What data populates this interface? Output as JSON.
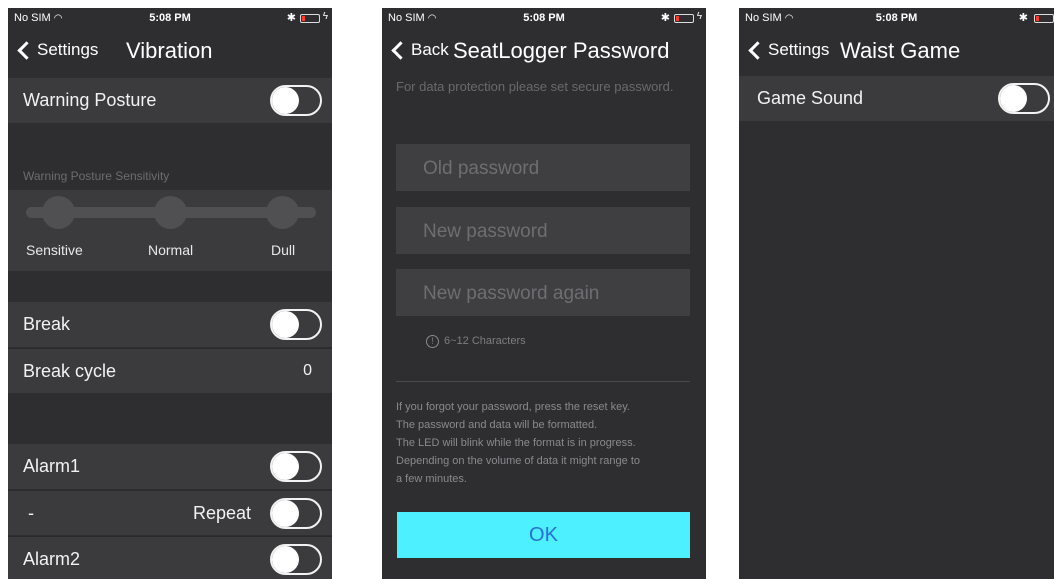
{
  "status_bar": {
    "carrier": "No SIM",
    "time": "5:08 PM",
    "bluetooth_icon": "bluetooth-icon",
    "battery_icon": "battery-low-icon"
  },
  "screen1": {
    "back_label": "Settings",
    "title": "Vibration",
    "warning_posture": {
      "label": "Warning Posture",
      "on": false
    },
    "sensitivity": {
      "section_label": "Warning Posture Sensitivity",
      "options": [
        "Sensitive",
        "Normal",
        "Dull"
      ]
    },
    "break": {
      "label": "Break",
      "on": false
    },
    "break_cycle": {
      "label": "Break cycle",
      "value": "0"
    },
    "alarm1": {
      "label": "Alarm1",
      "on": false
    },
    "alarm1_repeat": {
      "dash": "-",
      "label": "Repeat",
      "on": false
    },
    "alarm2": {
      "label": "Alarm2",
      "on": false
    }
  },
  "screen2": {
    "back_label": "Back",
    "title": "SeatLogger Password",
    "intro": "For data protection please set secure password.",
    "old_password_placeholder": "Old password",
    "new_password_placeholder": "New password",
    "new_password_again_placeholder": "New password again",
    "char_hint": "6~12 Characters",
    "reset_lines": [
      "If you forgot your password, press the reset key.",
      "The password and data will be formatted.",
      "The LED will blink while the format is in progress.",
      "Depending on the volume of data it might range to",
      "a few minutes."
    ],
    "ok_label": "OK",
    "accent_color": "#4df0fe"
  },
  "screen3": {
    "back_label": "Settings",
    "title": "Waist Game",
    "game_sound": {
      "label": "Game Sound",
      "on": false
    }
  }
}
